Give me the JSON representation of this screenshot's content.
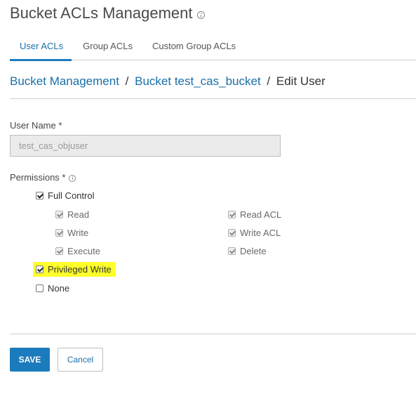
{
  "header": {
    "title": "Bucket ACLs Management",
    "title_info_icon": "info-icon"
  },
  "tabs": [
    {
      "label": "User ACLs",
      "active": true
    },
    {
      "label": "Group ACLs",
      "active": false
    },
    {
      "label": "Custom Group ACLs",
      "active": false
    }
  ],
  "breadcrumb": {
    "items": [
      "Bucket Management",
      "Bucket test_cas_bucket"
    ],
    "separator": "/",
    "current": "Edit User"
  },
  "form": {
    "user_name_label": "User Name *",
    "user_name_value": "test_cas_objuser",
    "permissions_label": "Permissions *",
    "permissions_info_icon": "info-icon",
    "permissions": {
      "full_control": {
        "label": "Full Control",
        "checked": true
      },
      "read": {
        "label": "Read",
        "checked": true,
        "disabled": true
      },
      "write": {
        "label": "Write",
        "checked": true,
        "disabled": true
      },
      "execute": {
        "label": "Execute",
        "checked": true,
        "disabled": true
      },
      "read_acl": {
        "label": "Read ACL",
        "checked": true,
        "disabled": true
      },
      "write_acl": {
        "label": "Write ACL",
        "checked": true,
        "disabled": true
      },
      "delete": {
        "label": "Delete",
        "checked": true,
        "disabled": true
      },
      "privileged_write": {
        "label": "Privileged Write",
        "checked": true,
        "highlighted": true,
        "highlight_color": "#ffff2a"
      },
      "none": {
        "label": "None",
        "checked": false
      }
    }
  },
  "actions": {
    "save_label": "SAVE",
    "cancel_label": "Cancel"
  },
  "colors": {
    "accent": "#1c7bbd",
    "link": "#1a6fa8",
    "highlight": "#ffff2a"
  }
}
